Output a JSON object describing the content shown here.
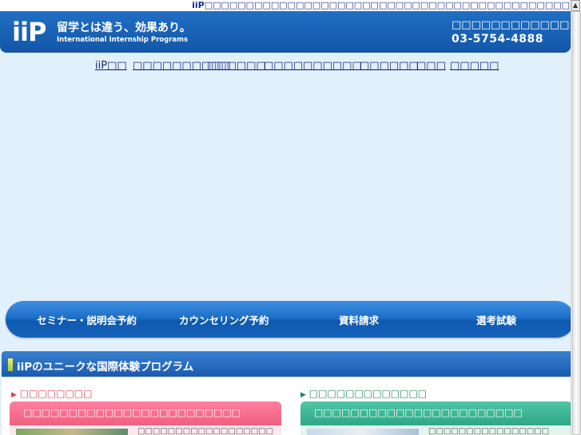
{
  "topbar": {
    "text": "iiP□□□□□□□□□□□□□□□□□□□□□□□□□□□□□□□□□□□□□□□□□□□□"
  },
  "header": {
    "logo_mark": "iiP",
    "tagline": "留学とは違う、効果あり。",
    "subtitle": "International Internship Programs",
    "contact_label": "□□□□□□□□□□□□",
    "phone": "03-5754-4888"
  },
  "nav": {
    "items": [
      {
        "label": "iiP□□"
      },
      {
        "label": "□□□□□□□□□□"
      },
      {
        "label": "□□□□□□"
      },
      {
        "label": "□□□□"
      },
      {
        "label": "□□□□□□"
      },
      {
        "label": "□□□□□□"
      },
      {
        "label": "□□□"
      },
      {
        "label": "□□□□□"
      }
    ]
  },
  "actions": {
    "seminar": "セミナー・説明会予約",
    "counseling": "カウンセリング予約",
    "brochure": "資料請求",
    "exam": "選考試験"
  },
  "section": {
    "title": "iiPのユニークな国際体験プログラム",
    "left_label": "□□□□□□□□",
    "right_label": "□□□□□□□□□□□□□",
    "left_card_title": "□□□□□□□□□□□□□□□□□□□□□□□□",
    "right_card_title": "□□□□□□□□□□□□□□□□□□□□□□□",
    "left_card_text": "□□□□□□□□□□□□□□□□□□",
    "right_card_text": "□□□□□□□□□□□□□□□□"
  },
  "colors": {
    "brand_blue": "#1f6fc4",
    "nav_text": "#1a2670",
    "pink_accent": "#f0607e",
    "green_accent": "#2fa886",
    "background": "#e2f0fc"
  }
}
